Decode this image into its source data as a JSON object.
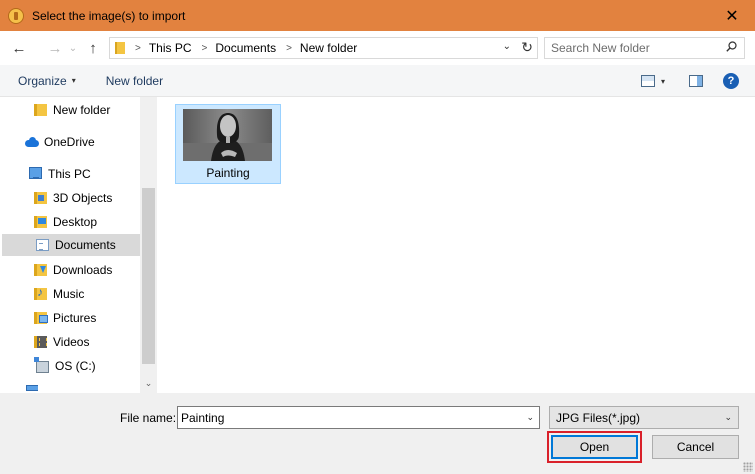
{
  "window": {
    "title": "Select the image(s) to import",
    "close_glyph": "✕"
  },
  "nav": {
    "back_glyph": "←",
    "forward_glyph": "→",
    "recent_glyph": "⌄",
    "up_glyph": "↑",
    "breadcrumb": [
      "This PC",
      "Documents",
      "New folder"
    ],
    "breadcrumb_sep": ">",
    "dropdown_glyph": "⌄",
    "refresh_glyph": "↻",
    "search_placeholder": "Search New folder"
  },
  "toolbar": {
    "organize_label": "Organize",
    "caret_glyph": "▾",
    "new_folder_label": "New folder",
    "help_glyph": "?"
  },
  "sidebar": {
    "items": [
      {
        "label": "New folder",
        "icon": "folder-icon"
      },
      {
        "label": "OneDrive",
        "icon": "cloud-icon"
      },
      {
        "label": "This PC",
        "icon": "computer-icon"
      },
      {
        "label": "3D Objects",
        "icon": "3d-objects-icon"
      },
      {
        "label": "Desktop",
        "icon": "desktop-icon"
      },
      {
        "label": "Documents",
        "icon": "documents-icon",
        "selected": true
      },
      {
        "label": "Downloads",
        "icon": "downloads-icon"
      },
      {
        "label": "Music",
        "icon": "music-icon"
      },
      {
        "label": "Pictures",
        "icon": "pictures-icon"
      },
      {
        "label": "Videos",
        "icon": "videos-icon"
      },
      {
        "label": "OS (C:)",
        "icon": "drive-icon"
      }
    ],
    "scroll_down_glyph": "⌄"
  },
  "files": [
    {
      "name": "Painting",
      "selected": true
    }
  ],
  "footer": {
    "file_name_label": "File name:",
    "file_name_value": "Painting",
    "file_type_value": "JPG Files(*.jpg)",
    "caret_glyph": "⌄",
    "open_label": "Open",
    "cancel_label": "Cancel"
  },
  "colors": {
    "titlebar": "#e2823f",
    "selection": "#cce8ff",
    "highlight": "#d9202a",
    "accent": "#0078d7"
  }
}
